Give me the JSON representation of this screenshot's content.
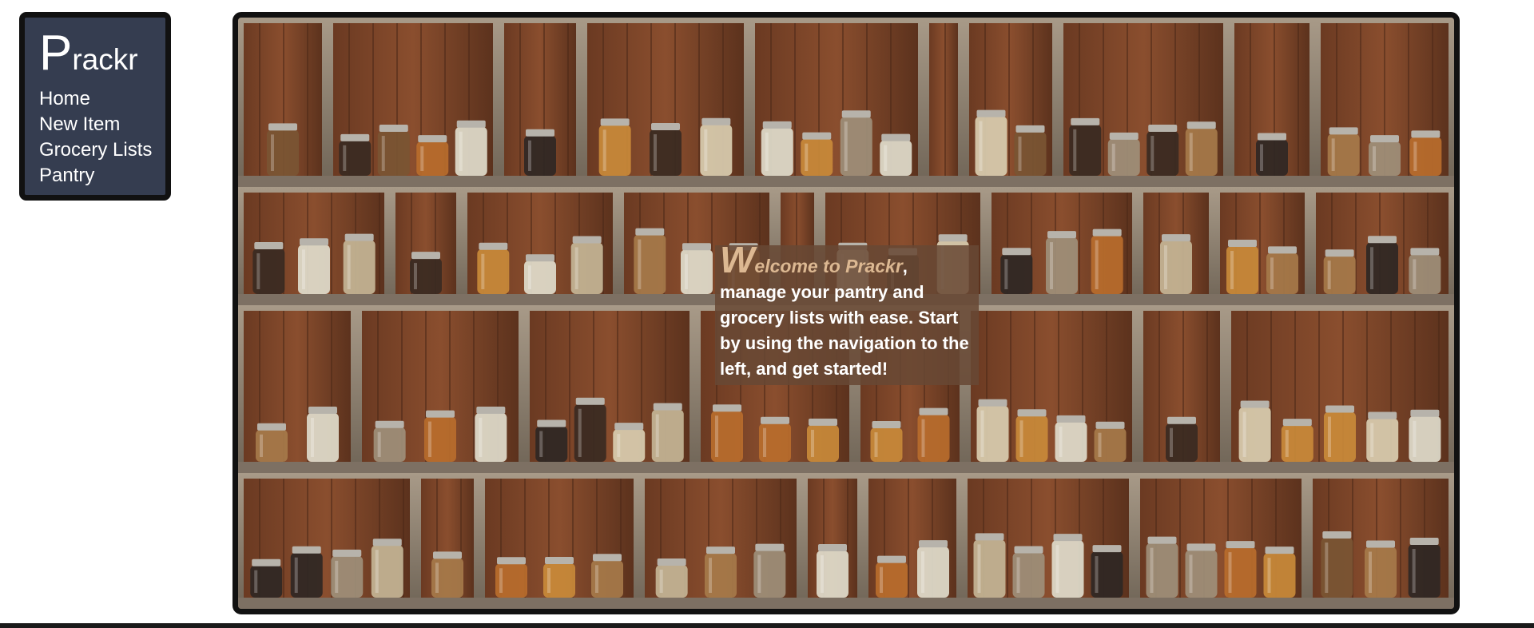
{
  "app": {
    "logo_initial": "P",
    "logo_rest": "rackr"
  },
  "sidebar": {
    "items": [
      {
        "label": "Home"
      },
      {
        "label": "New Item"
      },
      {
        "label": "Grocery Lists"
      },
      {
        "label": "Pantry"
      }
    ]
  },
  "hero": {
    "image_subject": "pantry-shelves-with-jars",
    "welcome_initial": "W",
    "welcome_head_rest": "elcome to Prackr",
    "welcome_comma": ",",
    "welcome_body": "manage your pantry and grocery lists with ease. Start by using the navigation to the left, and get started!"
  },
  "colors": {
    "sidebar_bg": "#353d50",
    "border": "#111111",
    "welcome_bg": "#684834",
    "welcome_accent": "#dcb892"
  }
}
